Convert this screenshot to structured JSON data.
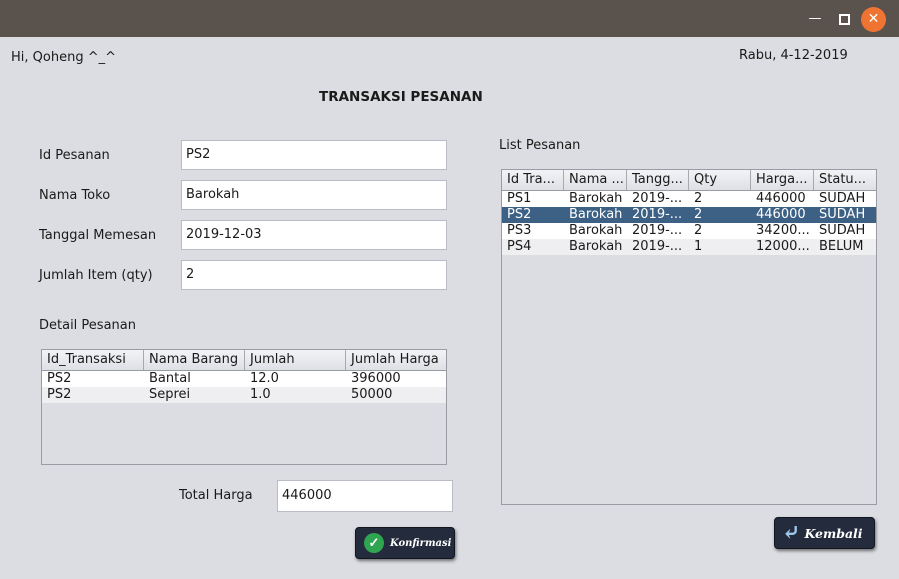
{
  "window": {
    "min_icon": "minimize-icon",
    "max_icon": "maximize-icon",
    "close_icon": "close-icon"
  },
  "header": {
    "greeting": "Hi, Qoheng ^_^",
    "date": "Rabu, 4-12-2019",
    "title": "TRANSAKSI PESANAN"
  },
  "form": {
    "id_label": "Id Pesanan",
    "id_value": "PS2",
    "toko_label": "Nama Toko",
    "toko_value": "Barokah",
    "tanggal_label": "Tanggal Memesan",
    "tanggal_value": "2019-12-03",
    "qty_label": "Jumlah Item (qty)",
    "qty_value": "2",
    "detail_label": "Detail Pesanan",
    "total_label": "Total Harga",
    "total_value": "446000"
  },
  "detail_table": {
    "columns": [
      "Id_Transaksi",
      "Nama Barang",
      "Jumlah",
      "Jumlah Harga"
    ],
    "rows": [
      [
        "PS2",
        "Bantal",
        "12.0",
        "396000"
      ],
      [
        "PS2",
        "Seprei",
        "1.0",
        "50000"
      ]
    ]
  },
  "list": {
    "label": "List Pesanan",
    "columns": [
      "Id Tra...",
      "Nama ...",
      "Tangg...",
      "Qty",
      "Harga...",
      "Statu..."
    ],
    "rows": [
      [
        "PS1",
        "Barokah",
        "2019-...",
        "2",
        "446000",
        "SUDAH"
      ],
      [
        "PS2",
        "Barokah",
        "2019-...",
        "2",
        "446000",
        "SUDAH"
      ],
      [
        "PS3",
        "Barokah",
        "2019-...",
        "2",
        "34200...",
        "SUDAH"
      ],
      [
        "PS4",
        "Barokah",
        "2019-...",
        "1",
        "12000...",
        "BELUM"
      ]
    ],
    "selected_row": 1
  },
  "buttons": {
    "konfirmasi": "Konfirmasi",
    "kembali": "Kembali"
  },
  "colors": {
    "titlebar": "#5a524c",
    "close": "#ef7432",
    "selection": "#3d6185",
    "button": "#232b3d",
    "check": "#2fa552"
  }
}
